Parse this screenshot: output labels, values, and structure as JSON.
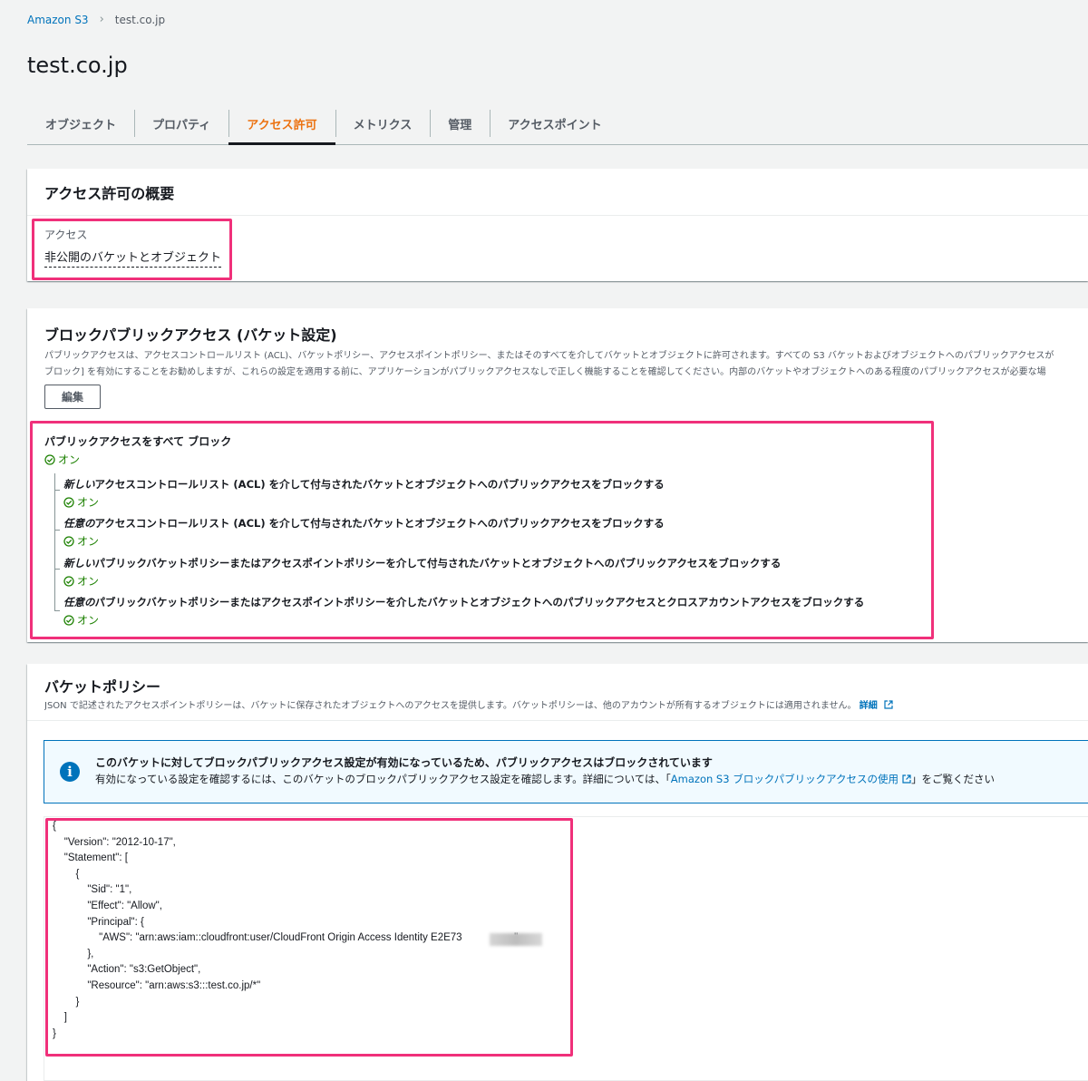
{
  "breadcrumb": {
    "root": "Amazon S3",
    "current": "test.co.jp"
  },
  "page_title": "test.co.jp",
  "tabs": [
    {
      "label": "オブジェクト"
    },
    {
      "label": "プロパティ"
    },
    {
      "label": "アクセス許可",
      "active": true
    },
    {
      "label": "メトリクス"
    },
    {
      "label": "管理"
    },
    {
      "label": "アクセスポイント"
    }
  ],
  "overview": {
    "title": "アクセス許可の概要",
    "access_label": "アクセス",
    "access_value": "非公開のバケットとオブジェクト"
  },
  "block_public_access": {
    "title": "ブロックパブリックアクセス (バケット設定)",
    "desc_line1": "パブリックアクセスは、アクセスコントロールリスト (ACL)、バケットポリシー、アクセスポイントポリシー、またはそのすべてを介してバケットとオブジェクトに許可されます。すべての S3 バケットおよびオブジェクトへのパブリックアクセスが",
    "desc_line2": "ブロック] を有効にすることをお勧めしますが、これらの設定を適用する前に、アプリケーションがパブリックアクセスなしで正しく機能することを確認してください。内部のバケットやオブジェクトへのある程度のパブリックアクセスが必要な場",
    "edit_button": "編集",
    "main_label": "パブリックアクセスをすべて ブロック",
    "main_status": "オン",
    "items": [
      {
        "lead": "新しい",
        "label": "アクセスコントロールリスト (ACL) を介して付与されたバケットとオブジェクトへのパブリックアクセスをブロックする",
        "status": "オン"
      },
      {
        "lead": "任意の",
        "label": "アクセスコントロールリスト (ACL) を介して付与されたバケットとオブジェクトへのパブリックアクセスをブロックする",
        "status": "オン"
      },
      {
        "lead": "新しい",
        "label": "パブリックバケットポリシーまたはアクセスポイントポリシーを介して付与されたバケットとオブジェクトへのパブリックアクセスをブロックする",
        "status": "オン"
      },
      {
        "lead": "任意の",
        "label": "パブリックバケットポリシーまたはアクセスポイントポリシーを介したバケットとオブジェクトへのパブリックアクセスとクロスアカウントアクセスをブロックする",
        "status": "オン"
      }
    ]
  },
  "bucket_policy": {
    "title": "バケットポリシー",
    "desc": "JSON で記述されたアクセスポイントポリシーは、バケットに保存されたオブジェクトへのアクセスを提供します。バケットポリシーは、他のアカウントが所有するオブジェクトには適用されません。",
    "desc_link": "詳細",
    "info_title": "このバケットに対してブロックパブリックアクセス設定が有効になっているため、パブリックアクセスはブロックされています",
    "info_text_before": "有効になっている設定を確認するには、このバケットのブロックパブリックアクセス設定を確認します。詳細については、「",
    "info_link": "Amazon S3 ブロックパブリックアクセスの使用",
    "info_text_after": "」をご覧ください",
    "policy_lines": [
      "{",
      "    \"Version\": \"2012-10-17\",",
      "    \"Statement\": [",
      "        {",
      "            \"Sid\": \"1\",",
      "            \"Effect\": \"Allow\",",
      "            \"Principal\": {",
      "                \"AWS\": \"arn:aws:iam::cloudfront:user/CloudFront Origin Access Identity E2E73                  \"",
      "            },",
      "            \"Action\": \"s3:GetObject\",",
      "            \"Resource\": \"arn:aws:s3:::test.co.jp/*\"",
      "        }",
      "    ]",
      "}"
    ]
  },
  "colors": {
    "accent_tab": "#ec7211",
    "link": "#0073bb",
    "success": "#1d8102",
    "highlight": "#f0307a",
    "info_bg": "#f1faff"
  }
}
